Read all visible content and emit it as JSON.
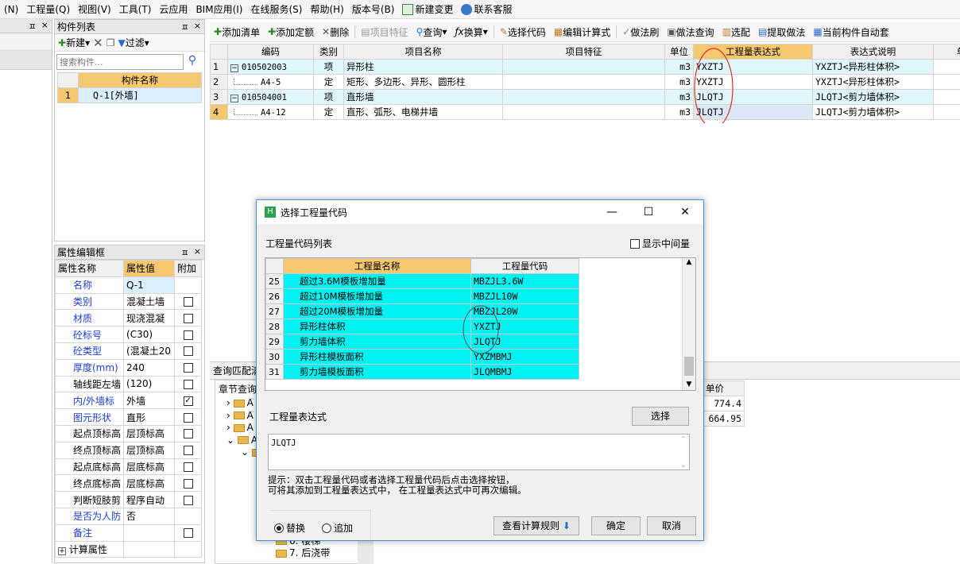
{
  "menu": [
    "(N)",
    "工程量(Q)",
    "视图(V)",
    "工具(T)",
    "云应用",
    "BIM应用(I)",
    "在线服务(S)",
    "帮助(H)",
    "版本号(B)",
    "新建变更",
    "联系客服"
  ],
  "comp_list": {
    "title": "构件列表",
    "new_label": "新建",
    "filter_label": "过滤",
    "search_placeholder": "搜索构件...",
    "col_header": "构件名称",
    "rows": [
      {
        "num": "1",
        "name": "Q-1[外墙]"
      }
    ]
  },
  "attr_panel": {
    "title": "属性编辑框",
    "headers": [
      "属性名称",
      "属性值",
      "附加"
    ],
    "rows": [
      {
        "name": "名称",
        "value": "Q-1",
        "blue": true,
        "cb": ""
      },
      {
        "name": "类别",
        "value": "混凝土墙",
        "blue": true,
        "cb": "box"
      },
      {
        "name": "材质",
        "value": "现浇混凝",
        "blue": true,
        "cb": "box"
      },
      {
        "name": "砼标号",
        "value": "(C30)",
        "blue": true,
        "cb": "box"
      },
      {
        "name": "砼类型",
        "value": "(混凝土20",
        "blue": true,
        "cb": "box"
      },
      {
        "name": "厚度(mm)",
        "value": "240",
        "blue": true,
        "cb": "box"
      },
      {
        "name": "轴线距左墙",
        "value": "(120)",
        "blue": false,
        "cb": "box"
      },
      {
        "name": "内/外墙标",
        "value": "外墙",
        "blue": true,
        "cb": "checked"
      },
      {
        "name": "图元形状",
        "value": "直形",
        "blue": true,
        "cb": "box"
      },
      {
        "name": "起点顶标高",
        "value": "层顶标高",
        "blue": false,
        "cb": "box"
      },
      {
        "name": "终点顶标高",
        "value": "层顶标高",
        "blue": false,
        "cb": "box"
      },
      {
        "name": "起点底标高",
        "value": "层底标高",
        "blue": false,
        "cb": "box"
      },
      {
        "name": "终点底标高",
        "value": "层底标高",
        "blue": false,
        "cb": "box"
      },
      {
        "name": "判断短肢剪",
        "value": "程序自动",
        "blue": false,
        "cb": "box"
      },
      {
        "name": "是否为人防",
        "value": "否",
        "blue": true,
        "cb": ""
      },
      {
        "name": "备注",
        "value": "",
        "blue": true,
        "cb": "box"
      },
      {
        "name": "计算属性",
        "value": "",
        "blue": false,
        "cb": ""
      }
    ]
  },
  "toolbar": [
    "添加清单",
    "添加定额",
    "删除",
    "项目特征",
    "查询",
    "换算",
    "选择代码",
    "编辑计算式",
    "做法刷",
    "做法查询",
    "选配",
    "提取做法",
    "当前构件自动套"
  ],
  "main_grid": {
    "headers": [
      "编码",
      "类别",
      "项目名称",
      "项目特征",
      "单位",
      "工程量表达式",
      "表达式说明",
      "单"
    ],
    "rows": [
      {
        "num": "1",
        "code": "010502003",
        "type": "项",
        "name": "异形柱",
        "feature": "",
        "unit": "m3",
        "expr": "YXZTJ",
        "desc": "YXZTJ<异形柱体积>",
        "tree": "minus"
      },
      {
        "num": "2",
        "code": "A4-5",
        "type": "定",
        "name": "矩形、多边形、异形、圆形柱",
        "feature": "",
        "unit": "m3",
        "expr": "YXZTJ",
        "desc": "YXZTJ<异形柱体积>",
        "tree": "child"
      },
      {
        "num": "3",
        "code": "010504001",
        "type": "项",
        "name": "直形墙",
        "feature": "",
        "unit": "m3",
        "expr": "JLQTJ",
        "desc": "JLQTJ<剪力墙体积>",
        "tree": "minus"
      },
      {
        "num": "4",
        "code": "A4-12",
        "type": "定",
        "name": "直形、弧形、电梯井墙",
        "feature": "",
        "unit": "m3",
        "expr": "JLQTJ",
        "desc": "JLQTJ<剪力墙体积>",
        "tree": "child"
      }
    ]
  },
  "bottom": {
    "tab1": "查询匹配清",
    "tab2": "章节查询",
    "price_header": "单价",
    "prices": [
      "774.4",
      "664.95"
    ],
    "folders": [
      "A",
      "A",
      "A",
      "A",
      "",
      "",
      "6. 楼梯",
      "7. 后浇带"
    ]
  },
  "dialog": {
    "title": "选择工程量代码",
    "list_label": "工程量代码列表",
    "show_mid": "显示中间量",
    "col_name": "工程量名称",
    "col_code": "工程量代码",
    "rows": [
      {
        "num": "25",
        "name": "超过3.6M模板增加量",
        "code": "MBZJL3.6W"
      },
      {
        "num": "26",
        "name": "超过10M模板增加量",
        "code": "MBZJL10W"
      },
      {
        "num": "27",
        "name": "超过20M模板增加量",
        "code": "MBZJL20W"
      },
      {
        "num": "28",
        "name": "异形柱体积",
        "code": "YXZTJ"
      },
      {
        "num": "29",
        "name": "剪力墙体积",
        "code": "JLQTJ"
      },
      {
        "num": "30",
        "name": "异形柱模板面积",
        "code": "YXZMBMJ"
      },
      {
        "num": "31",
        "name": "剪力墙模板面积",
        "code": "JLQMBMJ"
      }
    ],
    "expr_label": "工程量表达式",
    "select_btn": "选择",
    "expr_value": "JLQTJ",
    "hint": "提示：双击工程量代码或者选择工程量代码后点击选择按钮，\n可将其添加到工程量表达式中， 在工程量表达式中可再次编辑。",
    "replace": "替换",
    "append": "追加",
    "rules_btn": "查看计算规则",
    "ok": "确定",
    "cancel": "取消"
  },
  "colors": {
    "accent": "#f5c76e",
    "cyan": "#00f2f2",
    "row_hl": "#dff6fb",
    "circle": "#e0302a"
  }
}
